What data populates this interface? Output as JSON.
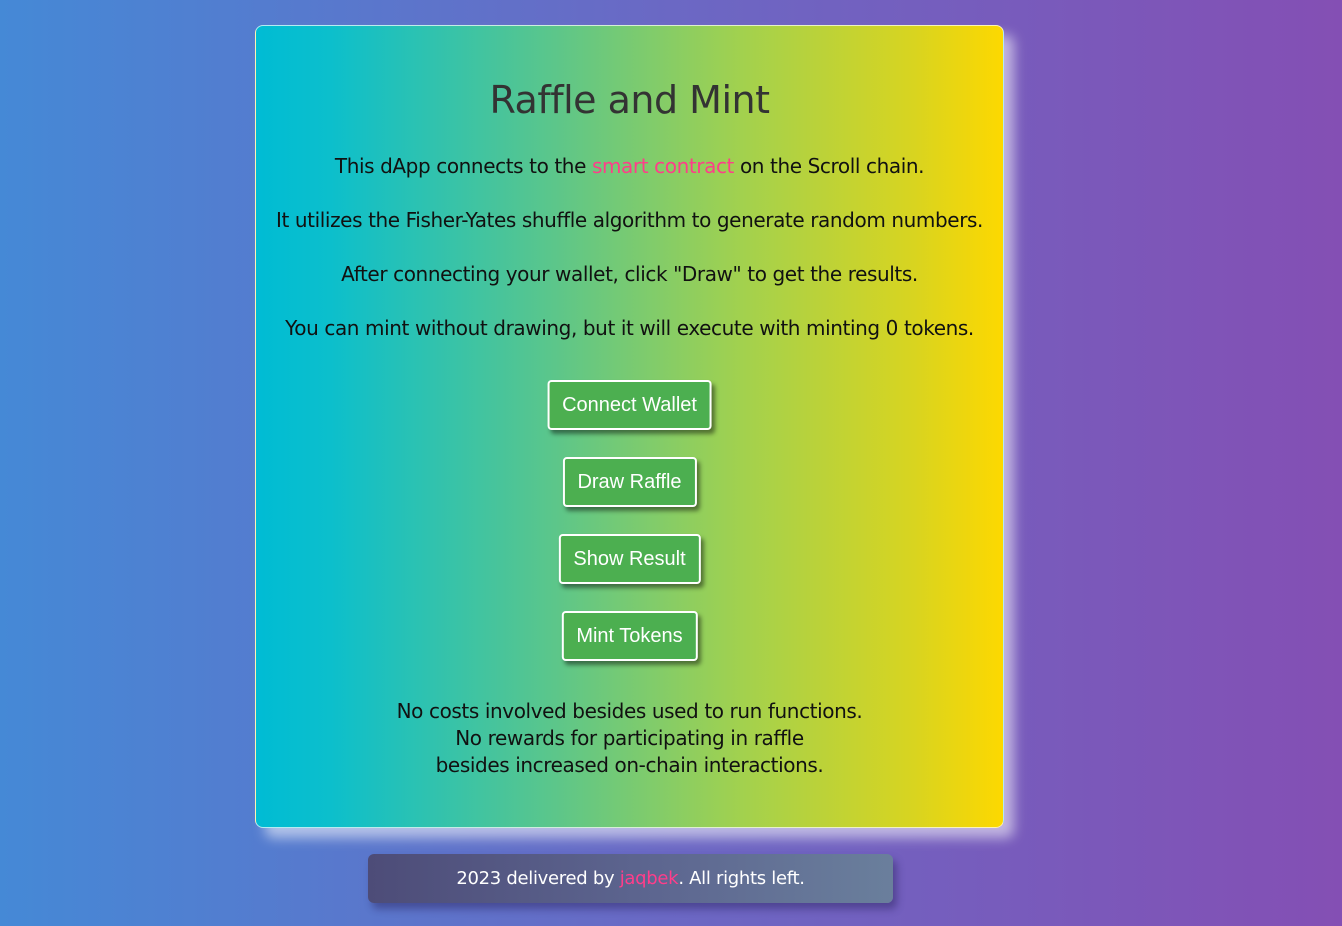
{
  "card": {
    "title": "Raffle and Mint",
    "intro_prefix": "This dApp connects to the ",
    "intro_link": "smart contract",
    "intro_suffix": " on the Scroll chain.",
    "line2": "It utilizes the Fisher-Yates shuffle algorithm to generate random numbers.",
    "line3": "After connecting your wallet, click \"Draw\" to get the results.",
    "line4": "You can mint without drawing, but it will execute with minting 0 tokens.",
    "buttons": {
      "connect": "Connect Wallet",
      "draw": "Draw Raffle",
      "show": "Show Result",
      "mint": "Mint Tokens"
    },
    "notes": [
      "No costs involved besides used to run functions.",
      "No rewards for participating in raffle",
      "besides increased on-chain interactions."
    ]
  },
  "footer": {
    "prefix": "2023 delivered by ",
    "author": "jaqbek",
    "suffix": ". All rights left."
  },
  "colors": {
    "button": "#4caf50",
    "link": "#ff3d8a",
    "card_gradient_start": "#00bcd4",
    "card_gradient_end": "#fdd800",
    "page_gradient_start": "#4589d6",
    "page_gradient_end": "#844fb4"
  }
}
